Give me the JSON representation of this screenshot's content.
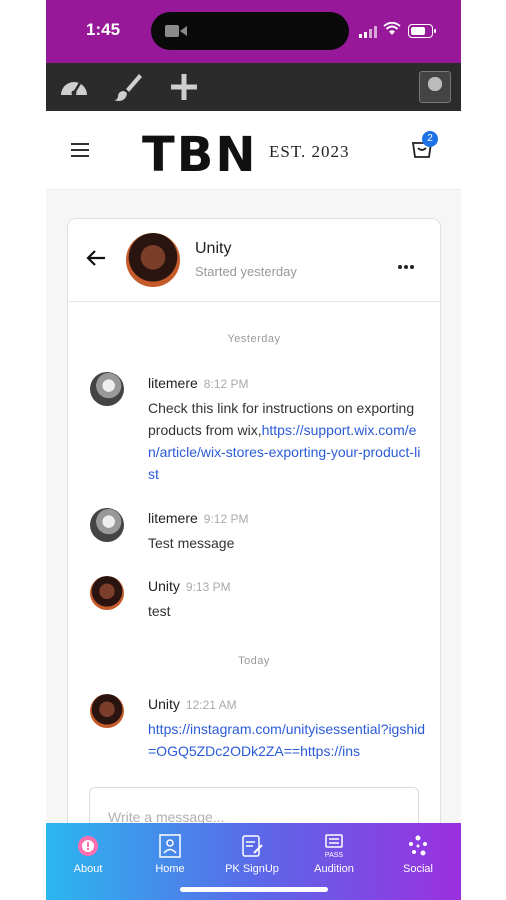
{
  "status_bar": {
    "time": "1:45"
  },
  "header": {
    "logo": "TBN",
    "est": "EST. 2023",
    "cart_count": "2"
  },
  "chat": {
    "contact_name": "Unity",
    "contact_status": "Started yesterday",
    "composer_placeholder": "Write a message...",
    "days": [
      "Yesterday",
      "Today"
    ],
    "messages": [
      {
        "author": "litemere",
        "time": "8:12 PM",
        "text": "Check this link for instructions on exporting products from wix,",
        "link": "https://support.wix.com/en/article/wix-stores-exporting-your-product-list"
      },
      {
        "author": "litemere",
        "time": "9:12 PM",
        "text": "Test message"
      },
      {
        "author": "Unity",
        "time": "9:13 PM",
        "text": "test"
      },
      {
        "author": "Unity",
        "time": "12:21 AM",
        "link": "https://instagram.com/unityisessential?igshid=OGQ5ZDc2ODk2ZA==https://ins"
      }
    ]
  },
  "bottom_nav": [
    {
      "label": "About"
    },
    {
      "label": "Home"
    },
    {
      "label": "PK SignUp"
    },
    {
      "label": "Audition",
      "icon_text": "PASS"
    },
    {
      "label": "Social"
    }
  ]
}
